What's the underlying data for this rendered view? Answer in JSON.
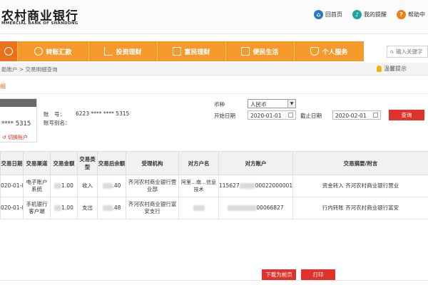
{
  "header": {
    "logo_cn": "农村商业银行",
    "logo_en": "MMERCIAL BANK OF SHANDONG",
    "links": [
      {
        "label": "回首页",
        "color": "#2a77c9"
      },
      {
        "label": "我的提醒",
        "color": "#20a3a0"
      },
      {
        "label": "帮助中",
        "color": "#ef7d10"
      }
    ]
  },
  "nav": {
    "items": [
      "转账汇款",
      "投资理财",
      "富民理财",
      "便民生活",
      "个人服务"
    ],
    "accent": "#f39a2b"
  },
  "search": {
    "placeholder": "输入关键字"
  },
  "breadcrumb": "助账户 > 交易明细查询",
  "tip": "温馨提示",
  "section_tag": "细",
  "card": {
    "number": "**** 5315",
    "switch_label": "切换账户"
  },
  "account": {
    "label": "账　号：",
    "value": "6223 **** **** 5315",
    "alias_label": "账号别名："
  },
  "form": {
    "currency_label": "币种",
    "currency_value": "人民币",
    "start_label": "开始日期",
    "start_value": "2020-01-01",
    "end_label": "截止日期",
    "end_value": "2020-02-01",
    "query_label": "查询"
  },
  "table": {
    "headers": [
      "交易日期",
      "交易渠道",
      "交易金额",
      "交易类型",
      "交易后余额",
      "受理机构",
      "对方户名",
      "对方账户",
      "交易摘要/附言"
    ],
    "rows": [
      {
        "date": "020-01-01",
        "channel": "电子账户系统",
        "amount": "1.00",
        "type": "收入",
        "balance": ".40",
        "org": "齐河农村商业银行营业部",
        "name": "阿里…南…信息技术",
        "account_a": "115627",
        "account_b": "00022000001",
        "memo": "资金转入  齐河农村商业银行营业"
      },
      {
        "date": "020-01-01",
        "channel": "手机银行客户端",
        "amount": "1.00",
        "type": "支出",
        "balance": ".48",
        "org": "齐河农村商业银行富安支行",
        "name": "",
        "account_a": "",
        "account_b": "00066827",
        "memo": "行内转账  齐河农村商业银行富安"
      }
    ]
  },
  "actions": {
    "download": "下载为前页",
    "print": "打印"
  }
}
